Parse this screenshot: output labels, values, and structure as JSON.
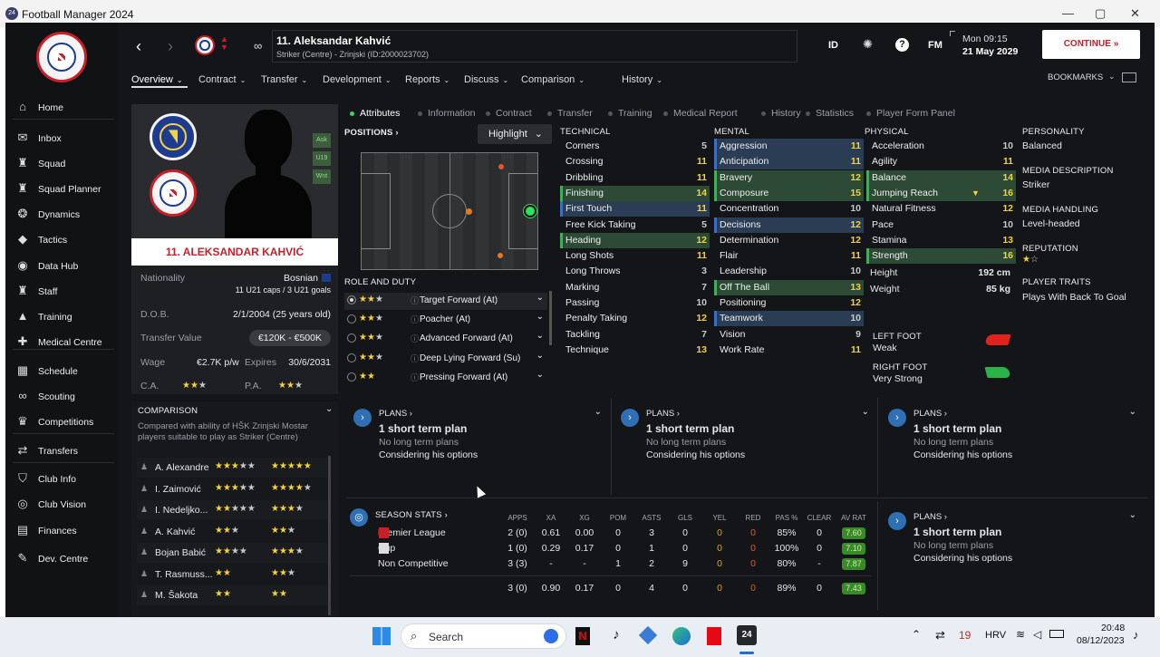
{
  "window": {
    "title": "Football Manager 2024",
    "icon": "24",
    "min": "—",
    "max": "▢",
    "close": "✕"
  },
  "sidebar": {
    "items": [
      {
        "label": "Home",
        "icon": "home-icon",
        "glyph": "⌂"
      },
      {
        "label": "Inbox",
        "icon": "mail-icon",
        "glyph": "✉"
      },
      {
        "label": "Squad",
        "icon": "shirt-icon",
        "glyph": "♜"
      },
      {
        "label": "Squad Planner",
        "icon": "planner-icon",
        "glyph": "♜"
      },
      {
        "label": "Dynamics",
        "icon": "dynamics-icon",
        "glyph": "❂"
      },
      {
        "label": "Tactics",
        "icon": "tactics-icon",
        "glyph": "◆"
      },
      {
        "label": "Data Hub",
        "icon": "datahub-icon",
        "glyph": "◉"
      },
      {
        "label": "Staff",
        "icon": "staff-icon",
        "glyph": "♜"
      },
      {
        "label": "Training",
        "icon": "training-icon",
        "glyph": "▲"
      },
      {
        "label": "Medical Centre",
        "icon": "medical-icon",
        "glyph": "✚"
      },
      {
        "label": "Schedule",
        "icon": "schedule-icon",
        "glyph": "▦"
      },
      {
        "label": "Scouting",
        "icon": "binoculars-icon",
        "glyph": "∞"
      },
      {
        "label": "Competitions",
        "icon": "trophy-icon",
        "glyph": "♛"
      },
      {
        "label": "Transfers",
        "icon": "transfers-icon",
        "glyph": "⇄"
      },
      {
        "label": "Club Info",
        "icon": "shield-icon",
        "glyph": "⛉"
      },
      {
        "label": "Club Vision",
        "icon": "vision-icon",
        "glyph": "◎"
      },
      {
        "label": "Finances",
        "icon": "finances-icon",
        "glyph": "▤"
      },
      {
        "label": "Dev. Centre",
        "icon": "devcentre-icon",
        "glyph": "✎"
      }
    ]
  },
  "header": {
    "player_name": "11. Aleksandar Kahvić",
    "subtitle": "Striker (Centre) - Zrinjski (ID:2000023702)",
    "id_label": "ID",
    "fm_label": "FM",
    "time": "Mon 09:15",
    "date": "21 May 2029",
    "continue": "CONTINUE",
    "bookmarks": "BOOKMARKS"
  },
  "menu": [
    "Overview",
    "Contract",
    "Transfer",
    "Development",
    "Reports",
    "Discuss",
    "Comparison",
    "History"
  ],
  "card": {
    "name": "11. ALEKSANDAR KAHVIĆ",
    "badges": [
      "Ask",
      "U19",
      "Wnt"
    ]
  },
  "profile": {
    "nationality_label": "Nationality",
    "nationality": "Bosnian",
    "caps": "11 U21 caps / 3 U21 goals",
    "dob_label": "D.O.B.",
    "dob": "2/1/2004 (25 years old)",
    "value_label": "Transfer Value",
    "value": "€120K - €500K",
    "wage_label": "Wage",
    "wage": "€2.7K p/w",
    "expires_label": "Expires",
    "expires": "30/6/2031",
    "ca_label": "C.A.",
    "pa_label": "P.A."
  },
  "subtabs": [
    "Attributes",
    "Information",
    "Contract",
    "Transfer",
    "Training",
    "Medical Report",
    "History",
    "Statistics",
    "Player Form Panel"
  ],
  "positions_label": "POSITIONS",
  "highlight": "Highlight",
  "role_label": "ROLE AND DUTY",
  "roles": [
    "Target Forward (At)",
    "Poacher (At)",
    "Advanced Forward (At)",
    "Deep Lying Forward (Su)",
    "Pressing Forward (At)"
  ],
  "technical": {
    "label": "TECHNICAL",
    "items": [
      {
        "n": "Corners",
        "v": "5"
      },
      {
        "n": "Crossing",
        "v": "11"
      },
      {
        "n": "Dribbling",
        "v": "11"
      },
      {
        "n": "Finishing",
        "v": "14"
      },
      {
        "n": "First Touch",
        "v": "11"
      },
      {
        "n": "Free Kick Taking",
        "v": "5"
      },
      {
        "n": "Heading",
        "v": "12"
      },
      {
        "n": "Long Shots",
        "v": "11"
      },
      {
        "n": "Long Throws",
        "v": "3"
      },
      {
        "n": "Marking",
        "v": "7"
      },
      {
        "n": "Passing",
        "v": "10"
      },
      {
        "n": "Penalty Taking",
        "v": "12"
      },
      {
        "n": "Tackling",
        "v": "7"
      },
      {
        "n": "Technique",
        "v": "13"
      }
    ]
  },
  "mental": {
    "label": "MENTAL",
    "items": [
      {
        "n": "Aggression",
        "v": "11"
      },
      {
        "n": "Anticipation",
        "v": "11"
      },
      {
        "n": "Bravery",
        "v": "12"
      },
      {
        "n": "Composure",
        "v": "15"
      },
      {
        "n": "Concentration",
        "v": "10"
      },
      {
        "n": "Decisions",
        "v": "12"
      },
      {
        "n": "Determination",
        "v": "12"
      },
      {
        "n": "Flair",
        "v": "11"
      },
      {
        "n": "Leadership",
        "v": "10"
      },
      {
        "n": "Off The Ball",
        "v": "13"
      },
      {
        "n": "Positioning",
        "v": "12"
      },
      {
        "n": "Teamwork",
        "v": "10"
      },
      {
        "n": "Vision",
        "v": "9"
      },
      {
        "n": "Work Rate",
        "v": "11"
      }
    ]
  },
  "physical": {
    "label": "PHYSICAL",
    "items": [
      {
        "n": "Acceleration",
        "v": "10"
      },
      {
        "n": "Agility",
        "v": "11"
      },
      {
        "n": "Balance",
        "v": "14"
      },
      {
        "n": "Jumping Reach",
        "v": "16"
      },
      {
        "n": "Natural Fitness",
        "v": "12"
      },
      {
        "n": "Pace",
        "v": "10"
      },
      {
        "n": "Stamina",
        "v": "13"
      },
      {
        "n": "Strength",
        "v": "16"
      }
    ],
    "height_label": "Height",
    "height": "192 cm",
    "weight_label": "Weight",
    "weight": "85 kg",
    "left_foot_label": "LEFT FOOT",
    "left_foot": "Weak",
    "right_foot_label": "RIGHT FOOT",
    "right_foot": "Very Strong"
  },
  "personality": {
    "label": "PERSONALITY",
    "value": "Balanced",
    "media_label": "MEDIA DESCRIPTION",
    "media": "Striker",
    "handling_label": "MEDIA HANDLING",
    "handling": "Level-headed",
    "reputation_label": "REPUTATION",
    "traits_label": "PLAYER TRAITS",
    "traits": "Plays With Back To Goal"
  },
  "comparison": {
    "label": "COMPARISON",
    "desc": "Compared with ability of HŠK Zrinjski Mostar players suitable to play as Striker (Centre)",
    "players": [
      "A. Alexandre",
      "I. Zaimović",
      "I. Nedeljko...",
      "A. Kahvić",
      "Bojan Babić",
      "T. Rasmuss...",
      "M. Šakota"
    ]
  },
  "plans": {
    "label": "PLANS",
    "short": "1 short term plan",
    "long": "No long term plans",
    "consider": "Considering his options"
  },
  "season": {
    "label": "SEASON STATS",
    "cols": [
      "APPS",
      "XA",
      "XG",
      "POM",
      "ASTS",
      "GLS",
      "YEL",
      "RED",
      "PAS %",
      "CLEAR",
      "AV RAT"
    ],
    "rows": [
      {
        "name": "Premier League",
        "vals": [
          "2 (0)",
          "0.61",
          "0.00",
          "0",
          "3",
          "0",
          "0",
          "0",
          "85%",
          "0",
          "7.60"
        ]
      },
      {
        "name": "Cup",
        "vals": [
          "1 (0)",
          "0.29",
          "0.17",
          "0",
          "1",
          "0",
          "0",
          "0",
          "100%",
          "0",
          "7.10"
        ]
      },
      {
        "name": "Non Competitive",
        "vals": [
          "3 (3)",
          "-",
          "-",
          "1",
          "2",
          "9",
          "0",
          "0",
          "80%",
          "-",
          "7.87"
        ]
      },
      {
        "name": "",
        "vals": [
          "3 (0)",
          "0.90",
          "0.17",
          "0",
          "4",
          "0",
          "0",
          "0",
          "89%",
          "0",
          "7.43"
        ]
      }
    ]
  },
  "taskbar": {
    "search": "Search",
    "lang": "HRV",
    "time": "20:48",
    "date": "08/12/2023",
    "badge": "19"
  }
}
